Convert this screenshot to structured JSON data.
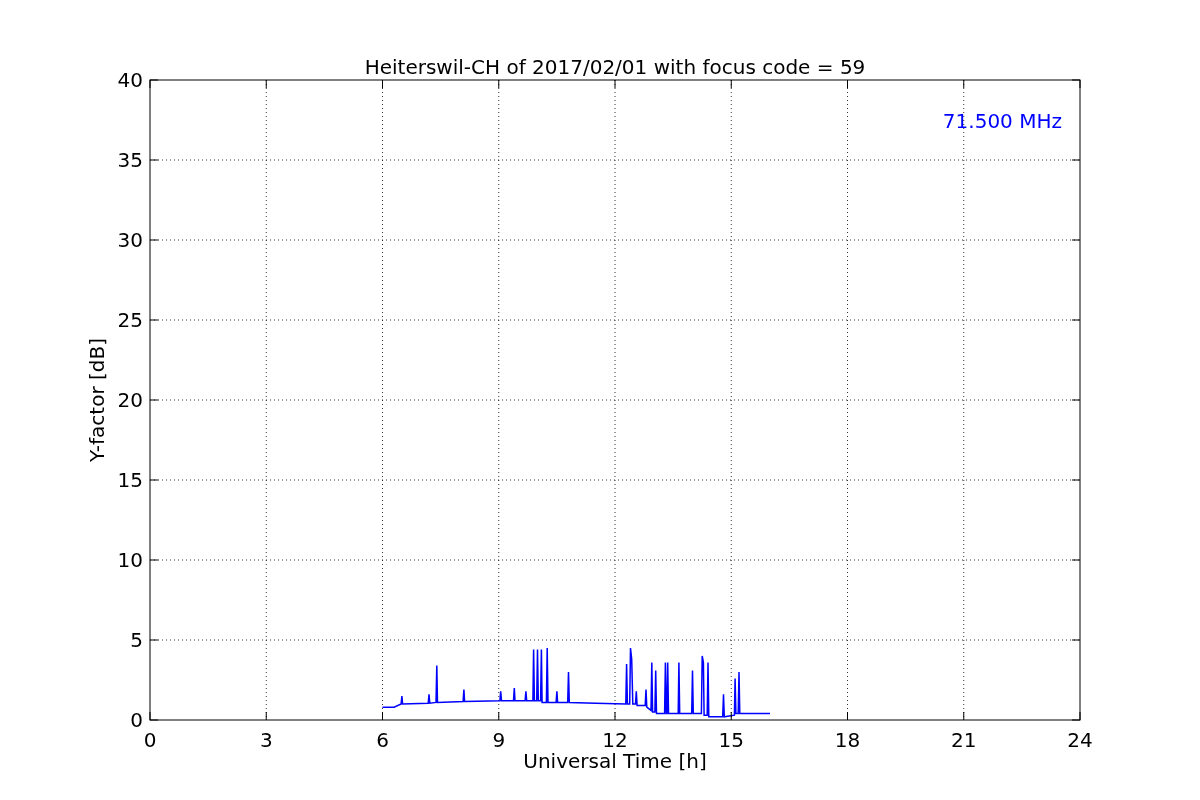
{
  "figure": {
    "chart_data": {
      "type": "line",
      "title": "Heiterswil-CH of 2017/02/01 with focus code = 59",
      "xlabel": "Universal Time [h]",
      "ylabel": "Y-factor [dB]",
      "xlim": [
        0,
        24
      ],
      "ylim": [
        0,
        40
      ],
      "xticks": [
        0,
        3,
        6,
        9,
        12,
        15,
        18,
        21,
        24
      ],
      "yticks": [
        0,
        5,
        10,
        15,
        20,
        25,
        30,
        35,
        40
      ],
      "x": [
        6.0,
        6.3,
        6.48,
        6.5,
        6.52,
        7.18,
        7.2,
        7.22,
        7.38,
        7.4,
        7.42,
        8.08,
        8.1,
        8.12,
        9.03,
        9.05,
        9.07,
        9.38,
        9.4,
        9.42,
        9.68,
        9.7,
        9.72,
        9.88,
        9.9,
        9.92,
        9.98,
        10.0,
        10.02,
        10.08,
        10.1,
        10.12,
        10.23,
        10.25,
        10.27,
        10.48,
        10.5,
        10.52,
        10.78,
        10.8,
        10.82,
        11.5,
        12.28,
        12.3,
        12.32,
        12.38,
        12.4,
        12.43,
        12.46,
        12.53,
        12.55,
        12.57,
        12.78,
        12.8,
        12.82,
        12.93,
        12.95,
        12.97,
        13.03,
        13.05,
        13.07,
        13.28,
        13.3,
        13.32,
        13.34,
        13.36,
        13.38,
        13.63,
        13.65,
        13.67,
        13.98,
        14.0,
        14.02,
        14.23,
        14.25,
        14.28,
        14.3,
        14.38,
        14.4,
        14.42,
        14.78,
        14.8,
        14.82,
        15.08,
        15.1,
        15.12,
        15.18,
        15.2,
        15.22,
        16.0
      ],
      "grid": true,
      "series": [
        {
          "color": "#0000ff",
          "values": [
            0.8,
            0.8,
            1.0,
            1.5,
            1.0,
            1.05,
            1.6,
            1.05,
            1.1,
            3.4,
            1.1,
            1.15,
            1.9,
            1.15,
            1.2,
            1.8,
            1.2,
            1.2,
            2.0,
            1.2,
            1.2,
            1.8,
            1.2,
            1.2,
            4.4,
            1.2,
            1.2,
            4.4,
            1.2,
            1.2,
            4.4,
            1.1,
            1.1,
            4.5,
            1.1,
            1.1,
            1.8,
            1.1,
            1.1,
            3.0,
            1.1,
            1.05,
            1.0,
            3.5,
            1.0,
            1.0,
            4.5,
            3.8,
            1.0,
            1.0,
            1.8,
            0.9,
            0.9,
            1.9,
            0.8,
            0.6,
            3.6,
            0.5,
            0.5,
            3.1,
            0.4,
            0.4,
            3.6,
            0.4,
            0.4,
            3.6,
            0.4,
            0.4,
            3.6,
            0.4,
            0.4,
            3.1,
            0.4,
            0.4,
            4.0,
            3.6,
            0.3,
            0.3,
            3.6,
            0.2,
            0.2,
            1.6,
            0.2,
            0.3,
            2.6,
            0.4,
            0.4,
            3.0,
            0.4,
            0.4
          ]
        }
      ],
      "annotations": [
        "71.500 MHz"
      ]
    }
  }
}
